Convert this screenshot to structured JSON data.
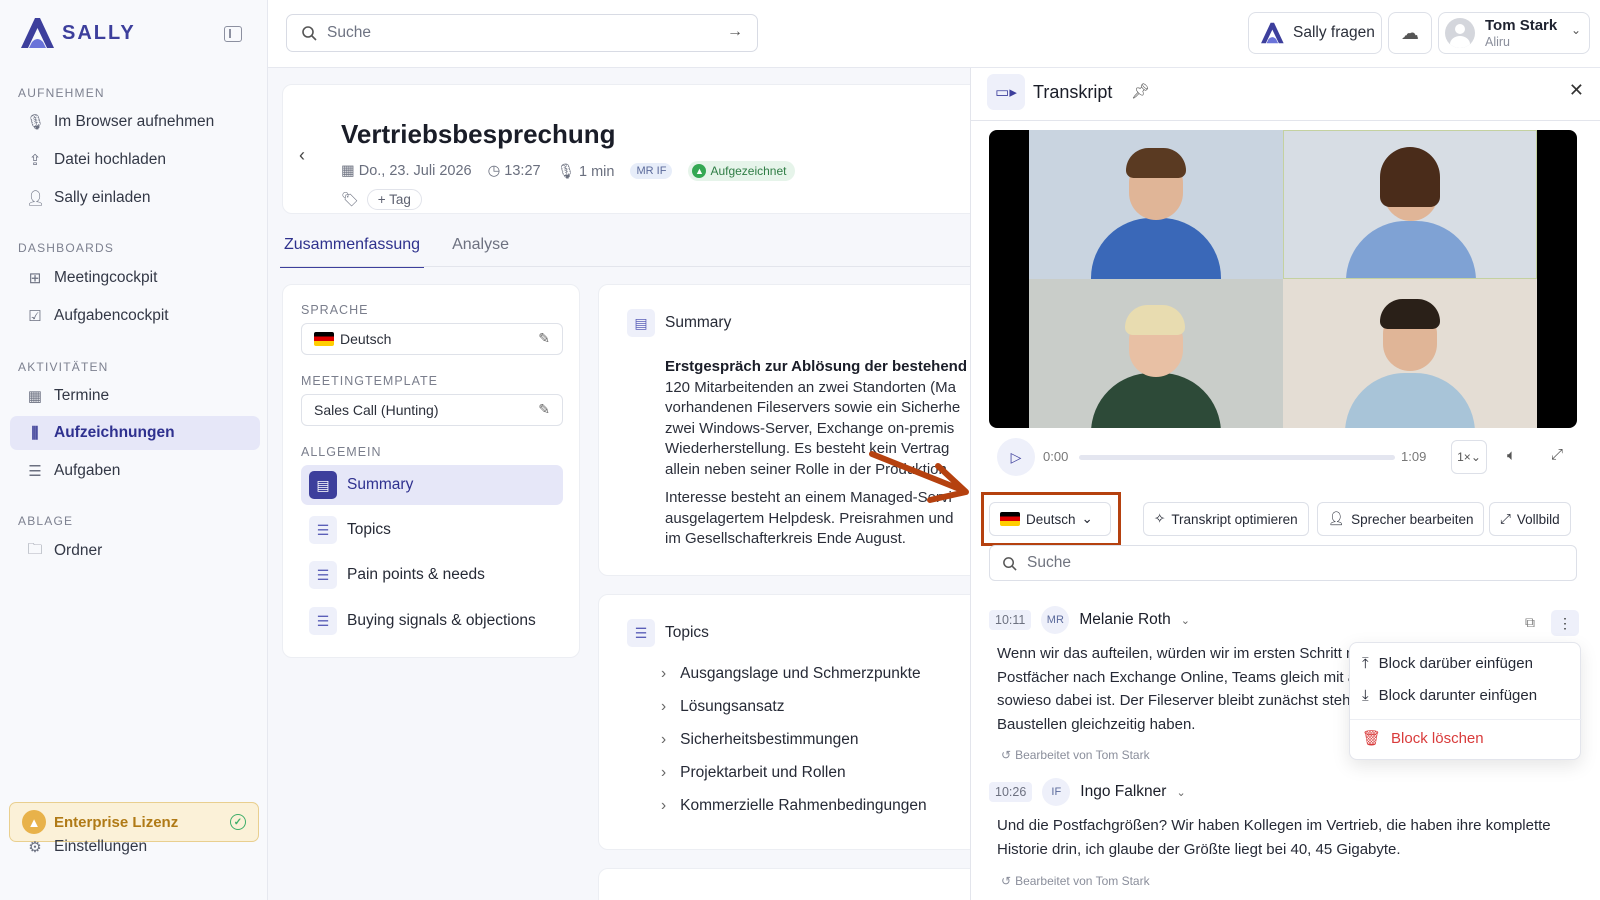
{
  "app": {
    "logo_text": "SALLY",
    "brand_color": "#3d3f9c"
  },
  "sidebar": {
    "sections": [
      {
        "label": "AUFNEHMEN",
        "items": [
          {
            "label": "Im Browser aufnehmen",
            "icon": "microphone-icon"
          },
          {
            "label": "Datei hochladen",
            "icon": "upload-icon"
          },
          {
            "label": "Sally einladen",
            "icon": "user-plus-icon"
          }
        ]
      },
      {
        "label": "DASHBOARDS",
        "items": [
          {
            "label": "Meetingcockpit",
            "icon": "grid-icon"
          },
          {
            "label": "Aufgabencockpit",
            "icon": "checkbox-icon"
          }
        ]
      },
      {
        "label": "AKTIVITÄTEN",
        "items": [
          {
            "label": "Termine",
            "icon": "calendar-icon"
          },
          {
            "label": "Aufzeichnungen",
            "icon": "waveform-icon",
            "active": true
          },
          {
            "label": "Aufgaben",
            "icon": "list-check-icon"
          }
        ]
      },
      {
        "label": "ABLAGE",
        "items": [
          {
            "label": "Ordner",
            "icon": "folder-icon"
          }
        ]
      }
    ],
    "license_label": "Enterprise Lizenz",
    "settings_label": "Einstellungen"
  },
  "topbar": {
    "search_placeholder": "Suche",
    "ask_label": "Sally fragen",
    "user_name": "Tom Stark",
    "user_org": "Aliru"
  },
  "meeting": {
    "title": "Vertriebsbesprechung",
    "date": "Do., 23. Juli 2026",
    "time": "13:27",
    "duration": "1 min",
    "participants": "MR IF",
    "status": "Aufgezeichnet",
    "tag_label": "Tag"
  },
  "tabs": [
    {
      "label": "Zusammenfassung",
      "active": true
    },
    {
      "label": "Analyse"
    }
  ],
  "settings": {
    "language_label": "SPRACHE",
    "language_value": "Deutsch",
    "template_label": "MEETINGTEMPLATE",
    "template_value": "Sales Call (Hunting)",
    "general_label": "ALLGEMEIN",
    "sections": [
      {
        "label": "Summary",
        "active": true
      },
      {
        "label": "Topics"
      },
      {
        "label": "Pain points & needs"
      },
      {
        "label": "Buying signals & objections"
      }
    ]
  },
  "summary": {
    "title": "Summary",
    "heading": "Erstgespräch zur Ablösung der bestehend",
    "lines": [
      "120 Mitarbeitenden an zwei Standorten (Ma",
      "vorhandenen Fileservers sowie ein Sicherhe",
      "zwei Windows-Server, Exchange on-premis",
      "Wiederherstellung. Es besteht kein Vertrag",
      "allein neben seiner Rolle in der Produktion"
    ],
    "para2": [
      "Interesse besteht an einem Managed-Servi",
      "ausgelagertem Helpdesk. Preisrahmen und",
      "im Gesellschafterkreis Ende August."
    ]
  },
  "topics": {
    "title": "Topics",
    "items": [
      "Ausgangslage und Schmerzpunkte",
      "Lösungsansatz",
      "Sicherheitsbestimmungen",
      "Projektarbeit und Rollen",
      "Kommerzielle Rahmenbedingungen"
    ]
  },
  "transcript": {
    "title": "Transkript",
    "player": {
      "current": "0:00",
      "total": "1:09",
      "speed": "1×",
      "progress": 0.0
    },
    "language": "Deutsch",
    "optimize_label": "Transkript optimieren",
    "speaker_label": "Sprecher bearbeiten",
    "fullscreen_label": "Vollbild",
    "search_placeholder": "Suche",
    "entries": [
      {
        "time": "10:11",
        "initials": "MR",
        "speaker": "Melanie Roth",
        "lines": [
          "Wenn wir das aufteilen, würden wir im ersten Schritt n",
          "Postfächer nach Exchange Online, Teams gleich mit a",
          "sowieso dabei ist. Der Fileserver bleibt zunächst steh",
          "Baustellen gleichzeitig haben."
        ],
        "edited": "Bearbeitet von Tom Stark"
      },
      {
        "time": "10:26",
        "initials": "IF",
        "speaker": "Ingo Falkner",
        "lines": [
          "Und die Postfachgrößen? Wir haben Kollegen im Vertrieb, die haben ihre komplette",
          "Historie drin, ich glaube der Größte liegt bei 40, 45 Gigabyte."
        ],
        "edited": "Bearbeitet von Tom Stark"
      }
    ],
    "menu": {
      "insert_above": "Block darüber einfügen",
      "insert_below": "Block darunter einfügen",
      "delete": "Block löschen"
    }
  },
  "colors": {
    "highlight": "#b5410f",
    "active_bg": "#e6e7f8",
    "license_bg": "#fbf1d8"
  }
}
